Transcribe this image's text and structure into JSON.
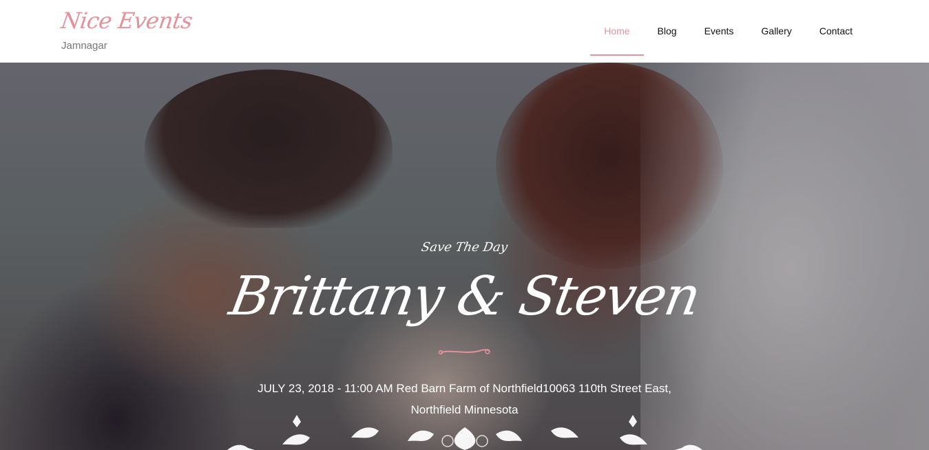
{
  "header": {
    "logo": "Nice Events",
    "location": "Jamnagar"
  },
  "nav": {
    "items": [
      {
        "label": "Home",
        "active": true
      },
      {
        "label": "Blog",
        "active": false
      },
      {
        "label": "Events",
        "active": false
      },
      {
        "label": "Gallery",
        "active": false
      },
      {
        "label": "Contact",
        "active": false
      }
    ]
  },
  "hero": {
    "subtitle": "Save The Day",
    "couple": "Brittany & Steven",
    "details": "JULY 23, 2018 - 11:00 AM Red Barn Farm of Northfield10063 110th Street East, Northfield Minnesota",
    "flourish_icon": "flourish-divider-icon",
    "ornament_icon": "floral-ornament-icon"
  },
  "colors": {
    "accent": "#e4919a",
    "nav_text": "#111111",
    "location_text": "#777777"
  }
}
